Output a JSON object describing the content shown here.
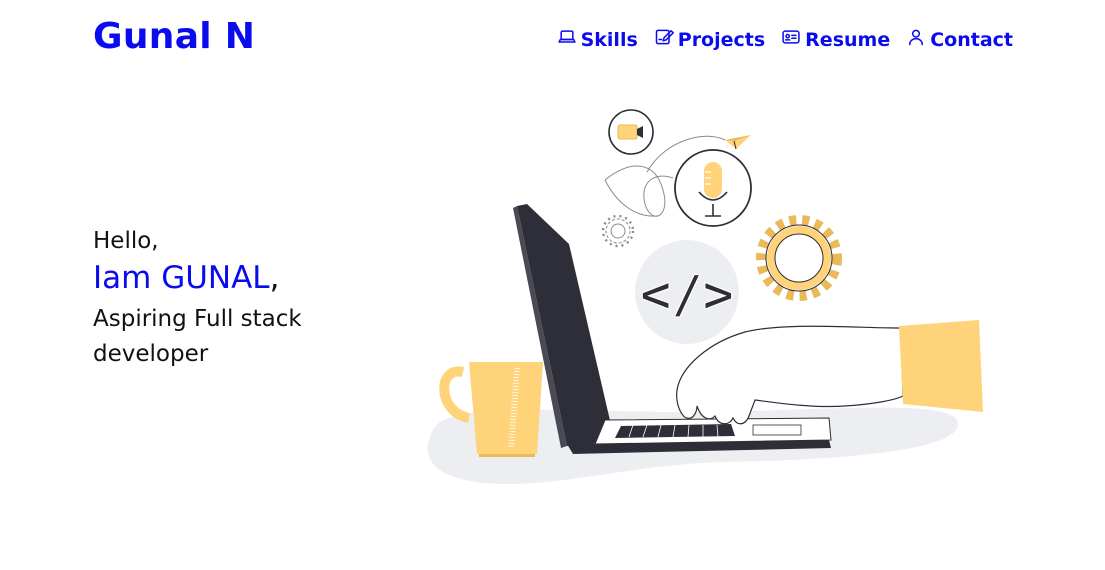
{
  "brand": {
    "name": "Gunal N"
  },
  "nav": {
    "items": [
      {
        "label": "Skills",
        "icon": "laptop-icon"
      },
      {
        "label": "Projects",
        "icon": "edit-icon"
      },
      {
        "label": "Resume",
        "icon": "id-card-icon"
      },
      {
        "label": "Contact",
        "icon": "user-icon"
      }
    ]
  },
  "hero": {
    "greeting": "Hello,",
    "intro_prefix": "Iam ",
    "name": "GUNAL",
    "intro_suffix": ",",
    "role": "Aspiring Full stack developer"
  },
  "illustration": {
    "code_symbol": "</>"
  },
  "colors": {
    "accent": "#0b0bef",
    "text": "#111111",
    "illustration_yellow": "#ffd37a",
    "illustration_dark": "#2e2e38",
    "illustration_gray": "#eceef1"
  }
}
